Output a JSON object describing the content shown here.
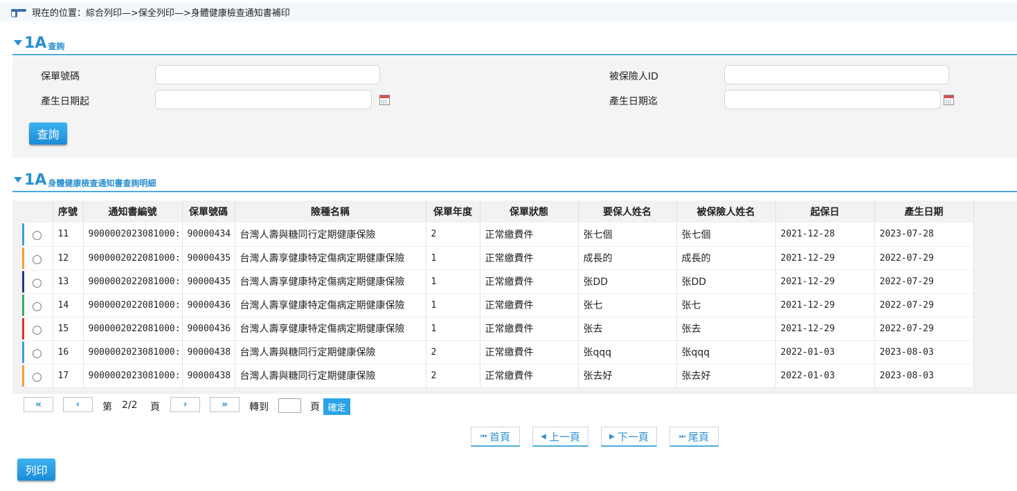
{
  "breadcrumb": {
    "text": "現在的位置：綜合列印—>保全列印—>身體健康檢查通知書補印",
    "icon": "pointing-hand-icon"
  },
  "query_section": {
    "badge": "1A",
    "title": "查詢"
  },
  "form": {
    "policy_no_label": "保單號碼",
    "insured_id_label": "被保險人ID",
    "date_from_label": "產生日期起",
    "date_to_label": "產生日期迄",
    "policy_no_value": "",
    "insured_id_value": "",
    "date_from_value": "",
    "date_to_value": "",
    "query_button": "查詢"
  },
  "result_section": {
    "badge": "1A",
    "title": "身體健康檢查通知書查詢明細"
  },
  "table": {
    "columns": [
      "序號",
      "通知書編號",
      "保單號碼",
      "險種名稱",
      "保單年度",
      "保單狀態",
      "要保人姓名",
      "被保險人姓名",
      "起保日",
      "產生日期"
    ],
    "rows": [
      {
        "seq": "11",
        "notice_no": "9000002023081000:",
        "policy_no": "90000434",
        "product": "台灣人壽與糖同行定期健康保險",
        "year": "2",
        "status": "正常繳費件",
        "applicant": "张七個",
        "insured": "张七個",
        "start_date": "2021-12-28",
        "created": "2023-07-28",
        "stripe": "#3aa0d8"
      },
      {
        "seq": "12",
        "notice_no": "9000002022081000:",
        "policy_no": "90000435",
        "product": "台灣人壽享健康特定傷病定期健康保險",
        "year": "1",
        "status": "正常繳費件",
        "applicant": "成長的",
        "insured": "成長的",
        "start_date": "2021-12-29",
        "created": "2022-07-29",
        "stripe": "#f0a030"
      },
      {
        "seq": "13",
        "notice_no": "9000002022081000:",
        "policy_no": "90000435",
        "product": "台灣人壽享健康特定傷病定期健康保險",
        "year": "1",
        "status": "正常繳費件",
        "applicant": "张DD",
        "insured": "张DD",
        "start_date": "2021-12-29",
        "created": "2022-07-29",
        "stripe": "#1a3a8a"
      },
      {
        "seq": "14",
        "notice_no": "9000002022081000:",
        "policy_no": "90000436",
        "product": "台灣人壽享健康特定傷病定期健康保險",
        "year": "1",
        "status": "正常繳費件",
        "applicant": "张七",
        "insured": "张七",
        "start_date": "2021-12-29",
        "created": "2022-07-29",
        "stripe": "#3aa86a"
      },
      {
        "seq": "15",
        "notice_no": "9000002022081000:",
        "policy_no": "90000436",
        "product": "台灣人壽享健康特定傷病定期健康保險",
        "year": "1",
        "status": "正常繳費件",
        "applicant": "张去",
        "insured": "张去",
        "start_date": "2021-12-29",
        "created": "2022-07-29",
        "stripe": "#d83030"
      },
      {
        "seq": "16",
        "notice_no": "9000002023081000:",
        "policy_no": "90000438",
        "product": "台灣人壽與糖同行定期健康保險",
        "year": "2",
        "status": "正常繳費件",
        "applicant": "张qqq",
        "insured": "张qqq",
        "start_date": "2022-01-03",
        "created": "2023-08-03",
        "stripe": "#3aa0d8"
      },
      {
        "seq": "17",
        "notice_no": "9000002023081000:",
        "policy_no": "90000438",
        "product": "台灣人壽與糖同行定期健康保險",
        "year": "2",
        "status": "正常繳費件",
        "applicant": "张去好",
        "insured": "张去好",
        "start_date": "2022-01-03",
        "created": "2023-08-03",
        "stripe": "#f0a030"
      }
    ]
  },
  "pager": {
    "first": "«",
    "prev": "‹",
    "next": "›",
    "last": "»",
    "page_prefix": "第",
    "page_info": "2/2",
    "page_suffix": "頁",
    "goto_label": "轉到",
    "goto_value": "",
    "goto_suffix": "頁",
    "confirm": "確定"
  },
  "nav": {
    "first": "首頁",
    "prev": "上一頁",
    "next": "下一頁",
    "last": "尾頁"
  },
  "print_button": "列印",
  "colors": {
    "accent": "#2a8fd0",
    "button": "#1a8cd8"
  }
}
